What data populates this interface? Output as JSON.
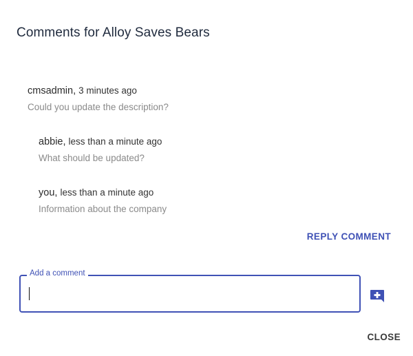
{
  "dialog": {
    "title": "Comments for Alloy Saves Bears"
  },
  "comments": [
    {
      "author": "cmsadmin",
      "time": "3 minutes ago",
      "text": "Could you update the description?"
    },
    {
      "author": "abbie",
      "time": "less than a minute ago",
      "text": "What should be updated?"
    },
    {
      "author": "you",
      "time": "less than a minute ago",
      "text": "Information about the company"
    }
  ],
  "actions": {
    "reply_label": "REPLY COMMENT",
    "close_label": "CLOSE"
  },
  "comment_field": {
    "label": "Add a comment",
    "value": "",
    "add_icon": "add-comment-icon"
  },
  "colors": {
    "accent": "#3f51b5",
    "secondary_text": "#8a8a8a",
    "title_text": "#1f2a3d"
  }
}
